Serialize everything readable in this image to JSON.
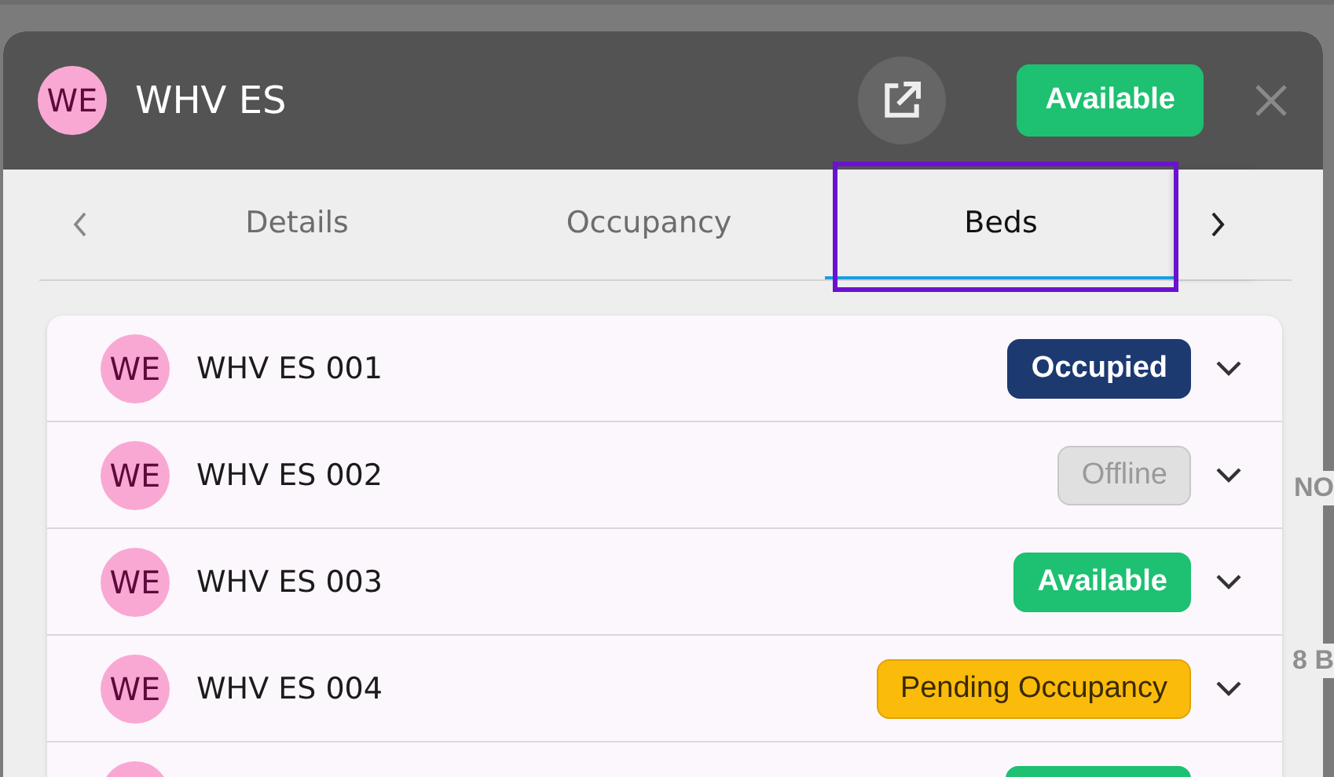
{
  "header": {
    "initials": "WE",
    "title": "WHV ES",
    "status": {
      "label": "Available",
      "kind": "available"
    }
  },
  "tabs": [
    {
      "label": "Details",
      "selected": false
    },
    {
      "label": "Occupancy",
      "selected": false
    },
    {
      "label": "Beds",
      "selected": true
    }
  ],
  "beds": [
    {
      "initials": "WE",
      "name": "WHV ES 001",
      "status": {
        "label": "Occupied",
        "kind": "occupied"
      }
    },
    {
      "initials": "WE",
      "name": "WHV ES 002",
      "status": {
        "label": "Offline",
        "kind": "offline"
      }
    },
    {
      "initials": "WE",
      "name": "WHV ES 003",
      "status": {
        "label": "Available",
        "kind": "available"
      }
    },
    {
      "initials": "WE",
      "name": "WHV ES 004",
      "status": {
        "label": "Pending Occupancy",
        "kind": "pending"
      }
    },
    {
      "status": {
        "kind": "available"
      }
    }
  ],
  "background_fragments": [
    "NO",
    "8 B"
  ]
}
